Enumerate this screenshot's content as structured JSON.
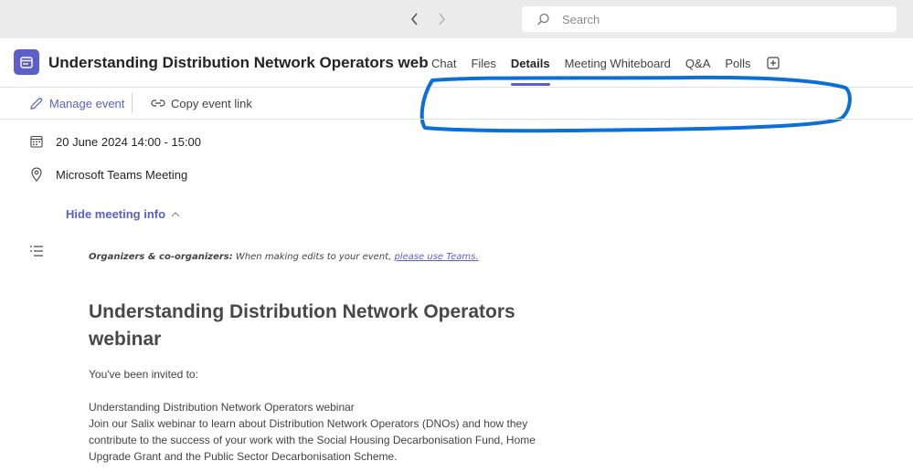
{
  "topbar": {
    "search_placeholder": "Search"
  },
  "header": {
    "title": "Understanding Distribution Network Operators webinar",
    "tabs": [
      {
        "label": "Chat"
      },
      {
        "label": "Files"
      },
      {
        "label": "Details",
        "active": true
      },
      {
        "label": "Meeting Whiteboard"
      },
      {
        "label": "Q&A"
      },
      {
        "label": "Polls"
      }
    ]
  },
  "toolbar": {
    "manage_label": "Manage event",
    "copy_label": "Copy event link"
  },
  "event": {
    "datetime": "20 June 2024 14:00 - 15:00",
    "location": "Microsoft Teams Meeting",
    "hide_info_label": "Hide meeting info"
  },
  "invitation": {
    "org_prefix": "Organizers & co-organizers:",
    "org_text": " When making edits to your event, ",
    "org_link": "please use Teams.",
    "title": "Understanding Distribution Network Operators webinar",
    "invited_text": "You've been invited to:",
    "desc_title": "Understanding Distribution Network Operators webinar",
    "desc_body": "Join our Salix webinar to learn about Distribution Network Operators (DNOs) and how they contribute to the success of your work with the Social Housing Decarbonisation Fund, Home Upgrade Grant and the Public Sector Decarbonisation Scheme."
  },
  "colors": {
    "accent": "#5b5fc7",
    "annotation": "#0a6fd6"
  },
  "icons": [
    "chevron-left-icon",
    "chevron-right-icon",
    "search-icon",
    "calendar-app-icon",
    "add-tab-icon",
    "pencil-icon",
    "link-icon",
    "calendar-icon",
    "location-pin-icon",
    "chevron-up-icon",
    "list-icon"
  ]
}
